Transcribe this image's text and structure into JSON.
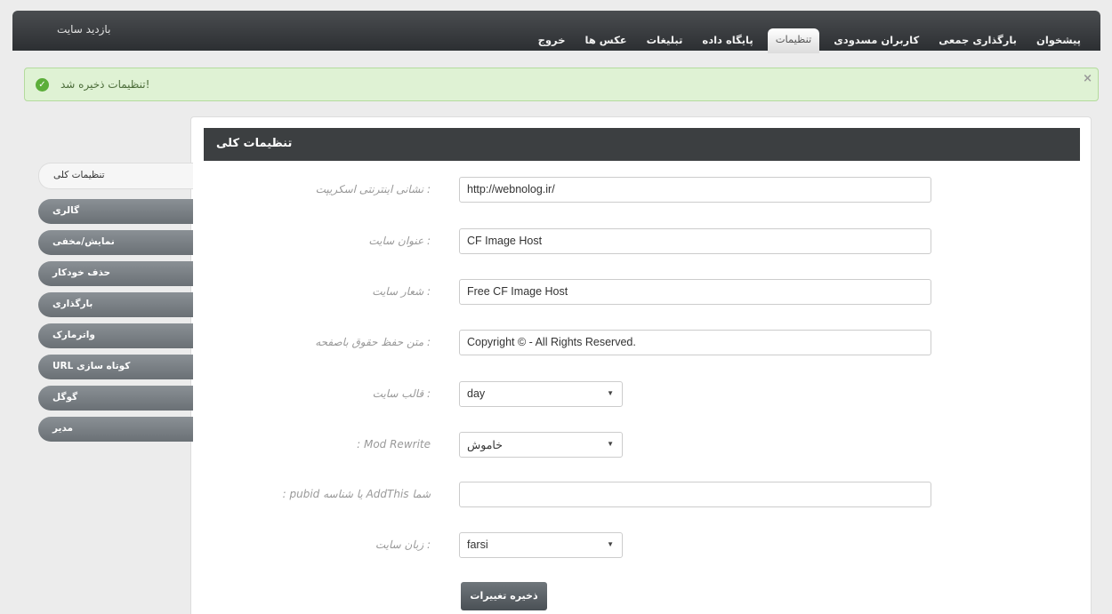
{
  "topbar": {
    "visit_site": "بازدید سایت",
    "nav": [
      {
        "label": "خروج",
        "name": "nav-logout"
      },
      {
        "label": "عکس ها",
        "name": "nav-images"
      },
      {
        "label": "تبلیغات",
        "name": "nav-ads"
      },
      {
        "label": "پایگاه داده",
        "name": "nav-database"
      },
      {
        "label": "تنظیمات",
        "name": "nav-settings",
        "active": true
      },
      {
        "label": "کاربران مسدودی",
        "name": "nav-blocked-users"
      },
      {
        "label": "بارگذاری جمعی",
        "name": "nav-bulk-upload"
      },
      {
        "label": "پیشخوان",
        "name": "nav-dashboard"
      }
    ]
  },
  "alert": {
    "message": "!تنظیمات ذخیره شد",
    "close": "×",
    "icon": "check-icon"
  },
  "sidebar": {
    "items": [
      {
        "label": "تنظیمات کلی",
        "active": true
      },
      {
        "label": "گالری"
      },
      {
        "label": "نمایش/مخفی"
      },
      {
        "label": "حذف خودکار"
      },
      {
        "label": "بارگذاری"
      },
      {
        "label": "واترمارک"
      },
      {
        "label": "کوتاه سازی URL"
      },
      {
        "label": "گوگل"
      },
      {
        "label": "مدیر"
      }
    ]
  },
  "panel": {
    "title": "تنظیمات کلی"
  },
  "form": {
    "script_url_label": ": نشانی اینترنتی اسکریپت",
    "script_url_value": "http://webnolog.ir/",
    "site_title_label": ": عنوان سایت",
    "site_title_value": "CF Image Host",
    "site_slogan_label": ": شعار سایت",
    "site_slogan_value": "Free CF Image Host",
    "copyright_label": ": متن حفظ حقوق باصفحه",
    "copyright_value": "Copyright © - All Rights Reserved.",
    "theme_label": ": قالب سایت",
    "theme_value": "day",
    "mod_rewrite_label": "Mod Rewrite :",
    "mod_rewrite_value": "خاموش",
    "addthis_label": "شما AddThis یا شناسه pubid :",
    "addthis_value": "",
    "language_label": ": زبان سایت",
    "language_value": "farsi",
    "save_label": "ذخیره تغییرات"
  }
}
